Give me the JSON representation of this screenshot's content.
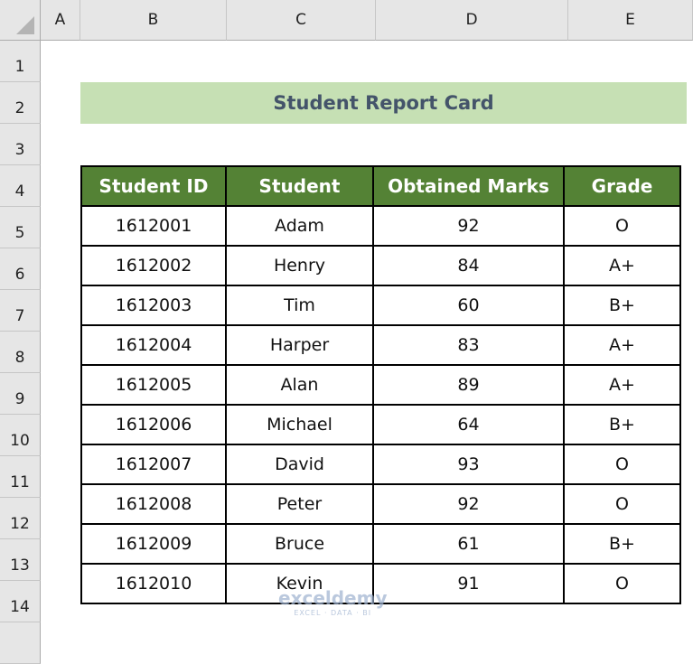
{
  "spreadsheet": {
    "columns": [
      "A",
      "B",
      "C",
      "D",
      "E"
    ],
    "rows": [
      "1",
      "2",
      "3",
      "4",
      "5",
      "6",
      "7",
      "8",
      "9",
      "10",
      "11",
      "12",
      "13",
      "14"
    ]
  },
  "report": {
    "title": "Student Report Card",
    "headers": [
      "Student ID",
      "Student",
      "Obtained Marks",
      "Grade"
    ],
    "rows": [
      {
        "id": "1612001",
        "student": "Adam",
        "marks": "92",
        "grade": "O"
      },
      {
        "id": "1612002",
        "student": "Henry",
        "marks": "84",
        "grade": "A+"
      },
      {
        "id": "1612003",
        "student": "Tim",
        "marks": "60",
        "grade": "B+"
      },
      {
        "id": "1612004",
        "student": "Harper",
        "marks": "83",
        "grade": "A+"
      },
      {
        "id": "1612005",
        "student": "Alan",
        "marks": "89",
        "grade": "A+"
      },
      {
        "id": "1612006",
        "student": "Michael",
        "marks": "64",
        "grade": "B+"
      },
      {
        "id": "1612007",
        "student": "David",
        "marks": "93",
        "grade": "O"
      },
      {
        "id": "1612008",
        "student": "Peter",
        "marks": "92",
        "grade": "O"
      },
      {
        "id": "1612009",
        "student": "Bruce",
        "marks": "61",
        "grade": "B+"
      },
      {
        "id": "1612010",
        "student": "Kevin",
        "marks": "91",
        "grade": "O"
      }
    ]
  },
  "colors": {
    "header_fill": "#548235",
    "title_fill": "#c6e0b4",
    "title_text": "#44546a"
  },
  "watermark": {
    "brand": "exceldemy",
    "tagline": "EXCEL · DATA · BI"
  }
}
